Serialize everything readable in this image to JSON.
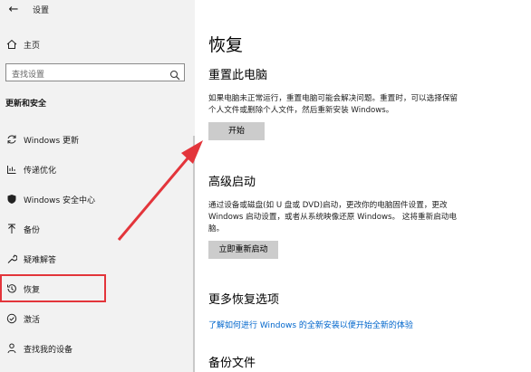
{
  "window": {
    "title": "设置",
    "back_icon": "arrow-left-icon"
  },
  "sidebar": {
    "home_label": "主页",
    "search_placeholder": "查找设置",
    "section_title": "更新和安全",
    "items": [
      {
        "label": "Windows 更新",
        "icon": "sync-icon"
      },
      {
        "label": "传递优化",
        "icon": "delivery-icon"
      },
      {
        "label": "Windows 安全中心",
        "icon": "shield-icon"
      },
      {
        "label": "备份",
        "icon": "backup-icon"
      },
      {
        "label": "疑难解答",
        "icon": "wrench-icon"
      },
      {
        "label": "恢复",
        "icon": "history-icon",
        "selected": true
      },
      {
        "label": "激活",
        "icon": "check-circle-icon"
      },
      {
        "label": "查找我的设备",
        "icon": "person-icon"
      }
    ]
  },
  "main": {
    "title": "恢复",
    "reset": {
      "heading": "重置此电脑",
      "description_line1": "如果电脑未正常运行，重置电脑可能会解决问题。重置时，可以选择保留",
      "description_line2": "个人文件或删除个人文件，然后重新安装 Windows。",
      "button_label": "开始"
    },
    "advanced": {
      "heading": "高级启动",
      "description_line1": "通过设备或磁盘(如 U 盘或 DVD)启动，更改你的电脑固件设置，更改",
      "description_line2": "Windows 启动设置，或者从系统映像还原 Windows。 这将重新启动电",
      "description_line3": "脑。",
      "button_label": "立即重新启动"
    },
    "more": {
      "heading": "更多恢复选项",
      "link_label": "了解如何进行 Windows 的全新安装以便开始全新的体验"
    },
    "backup_heading": "备份文件"
  },
  "annotation": {
    "color": "#e3353b"
  },
  "colors": {
    "sidebar_bg": "#f2f2f2",
    "link": "#0066cc",
    "button_bg": "#cccccc"
  }
}
